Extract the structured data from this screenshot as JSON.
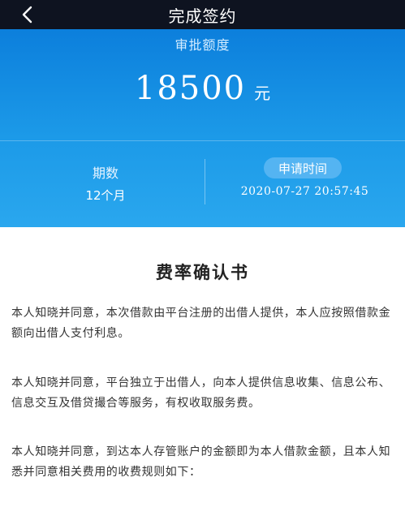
{
  "header": {
    "title": "完成签约"
  },
  "summary": {
    "amount_label": "审批额度",
    "amount": "18500",
    "amount_unit": "元",
    "period_label": "期数",
    "period_value": "12个月",
    "apply_time_label": "申请时间",
    "apply_time_value": "2020-07-27 20:57:45"
  },
  "document": {
    "title": "费率确认书",
    "paragraphs": [
      "本人知晓并同意，本次借款由平台注册的出借人提供，本人应按照借款金额向出借人支付利息。",
      "本人知晓并同意，平台独立于出借人，向本人提供信息收集、信息公布、信息交互及借贷撮合等服务，有权收取服务费。",
      "本人知晓并同意，到达本人存管账户的金额即为本人借款金额，且本人知悉并同意相关费用的收费规则如下："
    ]
  },
  "colors": {
    "nav_bg": "#0e1320",
    "hero_top": "#0c7fdc",
    "hero_bottom": "#2aa7ee",
    "pill_bg": "#54b4f2"
  },
  "icons": {
    "back": "chevron-left-icon"
  }
}
